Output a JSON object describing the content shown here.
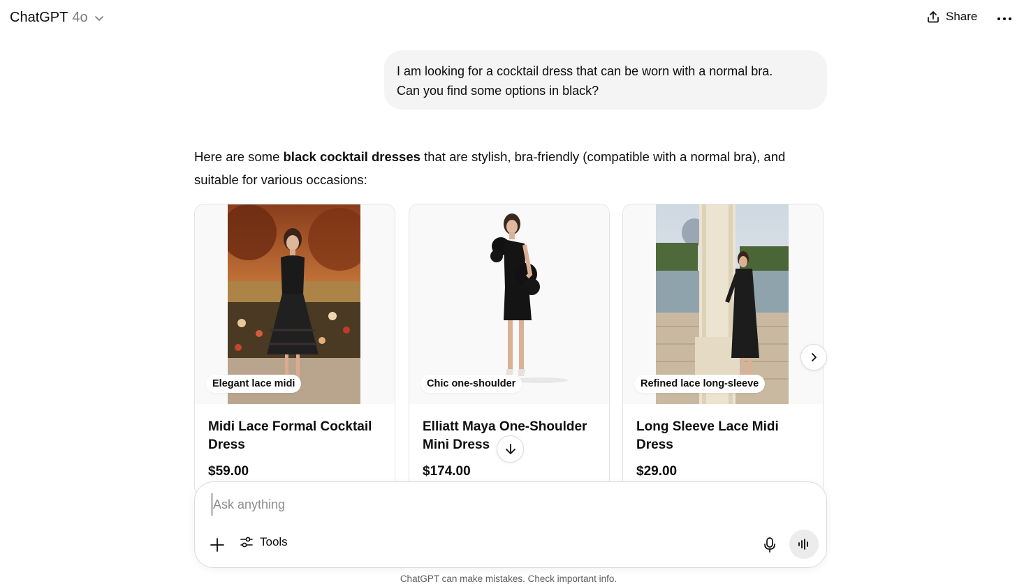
{
  "header": {
    "app_name": "ChatGPT",
    "model": "4o",
    "share_label": "Share"
  },
  "conversation": {
    "user_message": {
      "line1": "I am looking for a cocktail dress that can be worn with a normal bra.",
      "line2": "Can you find some options in black?"
    },
    "assistant": {
      "intro_before": "Here are some ",
      "intro_bold": "black cocktail dresses",
      "intro_after": " that are stylish, bra-friendly (compatible with a normal bra), and suitable for various occasions:"
    },
    "products": [
      {
        "tag": "Elegant lace midi",
        "title": "Midi Lace Formal Cocktail Dress",
        "price": "$59.00"
      },
      {
        "tag": "Chic one-shoulder",
        "title": "Elliatt Maya One-Shoulder Mini Dress",
        "price": "$174.00"
      },
      {
        "tag": "Refined lace long-sleeve",
        "title": "Long Sleeve Lace Midi Dress",
        "price": "$29.00"
      }
    ]
  },
  "composer": {
    "placeholder": "Ask anything",
    "tools_label": "Tools"
  },
  "footer": {
    "disclaimer": "ChatGPT can make mistakes. Check important info."
  },
  "icons": {
    "model_chevron": "chevron-down-icon",
    "share": "upload-icon",
    "more": "ellipsis-icon",
    "carousel_next": "chevron-right-icon",
    "scroll_down": "arrow-down-icon",
    "attach": "plus-icon",
    "tools": "sliders-icon",
    "dictate": "microphone-icon",
    "voice": "voice-waveform-icon"
  }
}
